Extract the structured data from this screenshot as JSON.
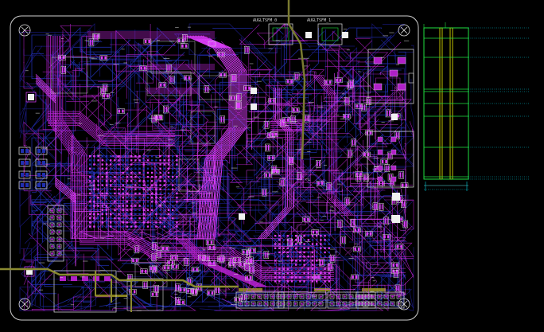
{
  "view": {
    "background": "#000000",
    "colors": {
      "board_outline": "#d8d8d8",
      "top_layer": "#b020c8",
      "bright_trace": "#e040ff",
      "inner_layer": "#2030b0",
      "bottom_layer": "#1a1a80",
      "silkscreen": "#e0e0e0",
      "copper_pour_yellow": "#a8a020",
      "olive_trace": "#8a8a30",
      "stackup_green": "#20e040",
      "stackup_yellow": "#f0f000",
      "stackup_dim": "#3a9a9a",
      "dimension_line": "#00c8d8",
      "pad_white": "#f0f0f0"
    }
  },
  "silkscreen_labels": {
    "mount_hole_marker": "X",
    "top_ref_1": "AUGLTSFM_0",
    "top_ref_2": "AUGLTSFM_1"
  },
  "stackup_panel": {
    "layer_count": 6
  }
}
